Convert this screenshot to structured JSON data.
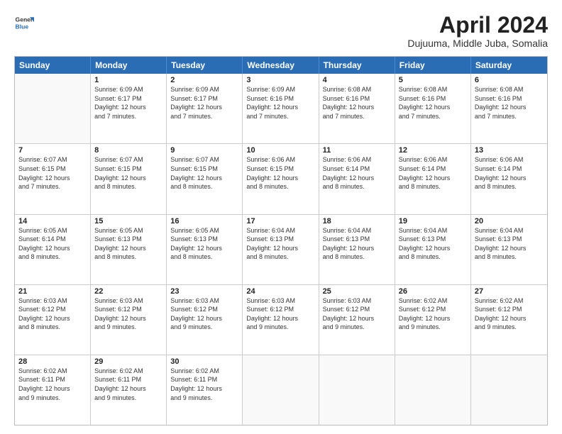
{
  "header": {
    "logo_line1": "General",
    "logo_line2": "Blue",
    "month_title": "April 2024",
    "location": "Dujuuma, Middle Juba, Somalia"
  },
  "days_of_week": [
    "Sunday",
    "Monday",
    "Tuesday",
    "Wednesday",
    "Thursday",
    "Friday",
    "Saturday"
  ],
  "weeks": [
    [
      {
        "day": "",
        "text": ""
      },
      {
        "day": "1",
        "text": "Sunrise: 6:09 AM\nSunset: 6:17 PM\nDaylight: 12 hours\nand 7 minutes."
      },
      {
        "day": "2",
        "text": "Sunrise: 6:09 AM\nSunset: 6:17 PM\nDaylight: 12 hours\nand 7 minutes."
      },
      {
        "day": "3",
        "text": "Sunrise: 6:09 AM\nSunset: 6:16 PM\nDaylight: 12 hours\nand 7 minutes."
      },
      {
        "day": "4",
        "text": "Sunrise: 6:08 AM\nSunset: 6:16 PM\nDaylight: 12 hours\nand 7 minutes."
      },
      {
        "day": "5",
        "text": "Sunrise: 6:08 AM\nSunset: 6:16 PM\nDaylight: 12 hours\nand 7 minutes."
      },
      {
        "day": "6",
        "text": "Sunrise: 6:08 AM\nSunset: 6:16 PM\nDaylight: 12 hours\nand 7 minutes."
      }
    ],
    [
      {
        "day": "7",
        "text": "Sunrise: 6:07 AM\nSunset: 6:15 PM\nDaylight: 12 hours\nand 7 minutes."
      },
      {
        "day": "8",
        "text": "Sunrise: 6:07 AM\nSunset: 6:15 PM\nDaylight: 12 hours\nand 8 minutes."
      },
      {
        "day": "9",
        "text": "Sunrise: 6:07 AM\nSunset: 6:15 PM\nDaylight: 12 hours\nand 8 minutes."
      },
      {
        "day": "10",
        "text": "Sunrise: 6:06 AM\nSunset: 6:15 PM\nDaylight: 12 hours\nand 8 minutes."
      },
      {
        "day": "11",
        "text": "Sunrise: 6:06 AM\nSunset: 6:14 PM\nDaylight: 12 hours\nand 8 minutes."
      },
      {
        "day": "12",
        "text": "Sunrise: 6:06 AM\nSunset: 6:14 PM\nDaylight: 12 hours\nand 8 minutes."
      },
      {
        "day": "13",
        "text": "Sunrise: 6:06 AM\nSunset: 6:14 PM\nDaylight: 12 hours\nand 8 minutes."
      }
    ],
    [
      {
        "day": "14",
        "text": "Sunrise: 6:05 AM\nSunset: 6:14 PM\nDaylight: 12 hours\nand 8 minutes."
      },
      {
        "day": "15",
        "text": "Sunrise: 6:05 AM\nSunset: 6:13 PM\nDaylight: 12 hours\nand 8 minutes."
      },
      {
        "day": "16",
        "text": "Sunrise: 6:05 AM\nSunset: 6:13 PM\nDaylight: 12 hours\nand 8 minutes."
      },
      {
        "day": "17",
        "text": "Sunrise: 6:04 AM\nSunset: 6:13 PM\nDaylight: 12 hours\nand 8 minutes."
      },
      {
        "day": "18",
        "text": "Sunrise: 6:04 AM\nSunset: 6:13 PM\nDaylight: 12 hours\nand 8 minutes."
      },
      {
        "day": "19",
        "text": "Sunrise: 6:04 AM\nSunset: 6:13 PM\nDaylight: 12 hours\nand 8 minutes."
      },
      {
        "day": "20",
        "text": "Sunrise: 6:04 AM\nSunset: 6:13 PM\nDaylight: 12 hours\nand 8 minutes."
      }
    ],
    [
      {
        "day": "21",
        "text": "Sunrise: 6:03 AM\nSunset: 6:12 PM\nDaylight: 12 hours\nand 8 minutes."
      },
      {
        "day": "22",
        "text": "Sunrise: 6:03 AM\nSunset: 6:12 PM\nDaylight: 12 hours\nand 9 minutes."
      },
      {
        "day": "23",
        "text": "Sunrise: 6:03 AM\nSunset: 6:12 PM\nDaylight: 12 hours\nand 9 minutes."
      },
      {
        "day": "24",
        "text": "Sunrise: 6:03 AM\nSunset: 6:12 PM\nDaylight: 12 hours\nand 9 minutes."
      },
      {
        "day": "25",
        "text": "Sunrise: 6:03 AM\nSunset: 6:12 PM\nDaylight: 12 hours\nand 9 minutes."
      },
      {
        "day": "26",
        "text": "Sunrise: 6:02 AM\nSunset: 6:12 PM\nDaylight: 12 hours\nand 9 minutes."
      },
      {
        "day": "27",
        "text": "Sunrise: 6:02 AM\nSunset: 6:12 PM\nDaylight: 12 hours\nand 9 minutes."
      }
    ],
    [
      {
        "day": "28",
        "text": "Sunrise: 6:02 AM\nSunset: 6:11 PM\nDaylight: 12 hours\nand 9 minutes."
      },
      {
        "day": "29",
        "text": "Sunrise: 6:02 AM\nSunset: 6:11 PM\nDaylight: 12 hours\nand 9 minutes."
      },
      {
        "day": "30",
        "text": "Sunrise: 6:02 AM\nSunset: 6:11 PM\nDaylight: 12 hours\nand 9 minutes."
      },
      {
        "day": "",
        "text": ""
      },
      {
        "day": "",
        "text": ""
      },
      {
        "day": "",
        "text": ""
      },
      {
        "day": "",
        "text": ""
      }
    ]
  ]
}
